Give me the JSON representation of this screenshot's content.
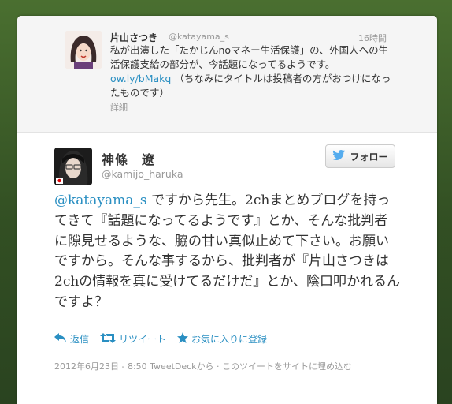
{
  "parent_tweet": {
    "name": "片山さつき",
    "handle": "@katayama_s",
    "time": "16時間",
    "text_before_link": "私が出演した「たかじんnoマネー生活保護」の、外国人への生活保護支給の部分が、今話題になってるようです。",
    "link": "ow.ly/bMakq",
    "text_after_link": "（ちなみにタイトルは投稿者の方がおつけになったものです）",
    "details": "詳細"
  },
  "tweet": {
    "name": "神條　遼",
    "handle": "@kamijo_haruka",
    "follow_label": "フォロー",
    "mention": "@katayama_s",
    "text": " ですから先生。2chまとめブログを持ってきて『話題になってるようです』とか、そんな批判者に隙見せるような、脇の甘い真似止めて下さい。お願いですから。そんな事するから、批判者が『片山さつきは2chの情報を真に受けてるだけだ』とか、陰口叩かれるんですよ？",
    "actions": {
      "reply": "返信",
      "retweet": "リツイート",
      "favorite": "お気に入りに登録"
    },
    "meta": "2012年6月23日 - 8:50 TweetDeckから · このツイートをサイトに埋め込む"
  },
  "colors": {
    "link": "#2a8fc2",
    "background": "#3a5a2a"
  }
}
